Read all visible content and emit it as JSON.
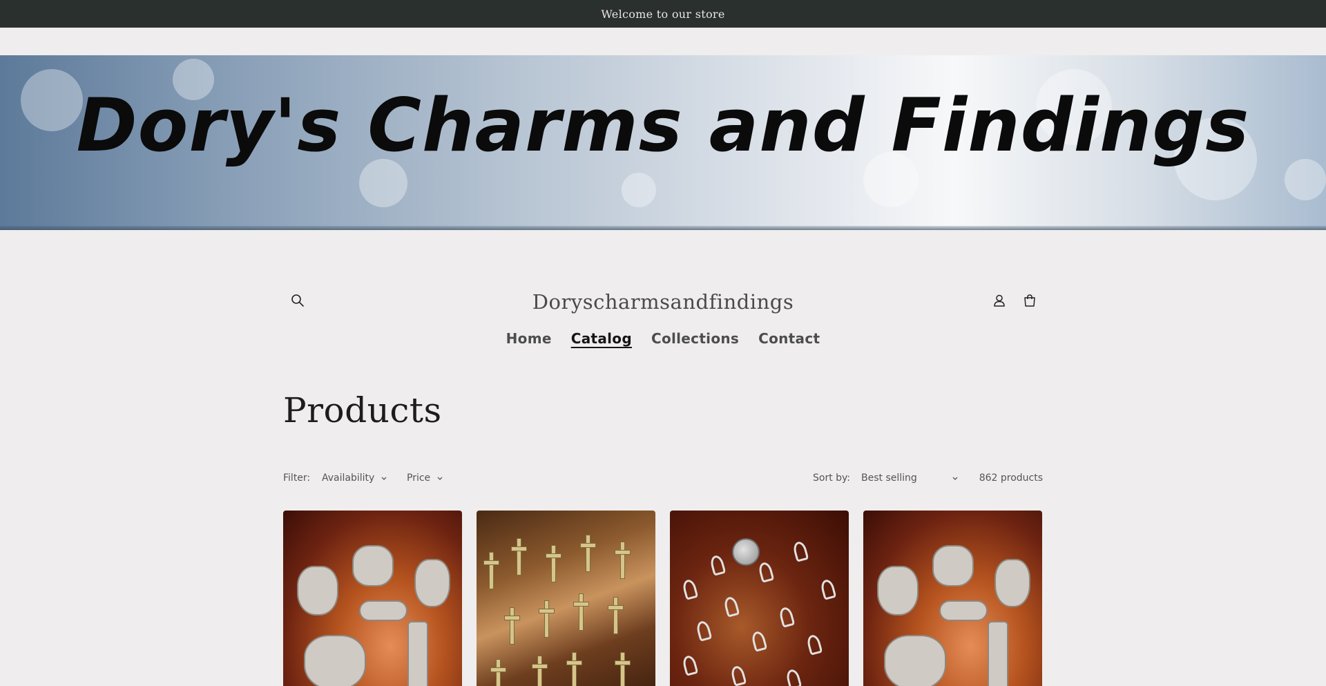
{
  "announcement": {
    "text": "Welcome to our store"
  },
  "banner": {
    "text": "Dory's Charms and Findings"
  },
  "header": {
    "store_name": "Doryscharmsandfindings",
    "icons": [
      "search-icon",
      "account-icon",
      "cart-icon"
    ]
  },
  "nav": {
    "items": [
      {
        "label": "Home",
        "active": false
      },
      {
        "label": "Catalog",
        "active": true
      },
      {
        "label": "Collections",
        "active": false
      },
      {
        "label": "Contact",
        "active": false
      }
    ]
  },
  "page": {
    "title": "Products"
  },
  "toolbar": {
    "filter_label": "Filter:",
    "availability_label": "Availability",
    "price_label": "Price",
    "sort_label": "Sort by:",
    "sort_value": "Best selling",
    "count_text": "862 products"
  },
  "products": [
    {
      "image": "silver-warrior-charms"
    },
    {
      "image": "gold-cross-charms"
    },
    {
      "image": "silver-ribbon-charms"
    },
    {
      "image": "silver-warrior-charms"
    }
  ],
  "colors": {
    "announcement_bg": "#2a302e",
    "page_bg": "#efeded",
    "text_dark": "#1d1d1d"
  }
}
